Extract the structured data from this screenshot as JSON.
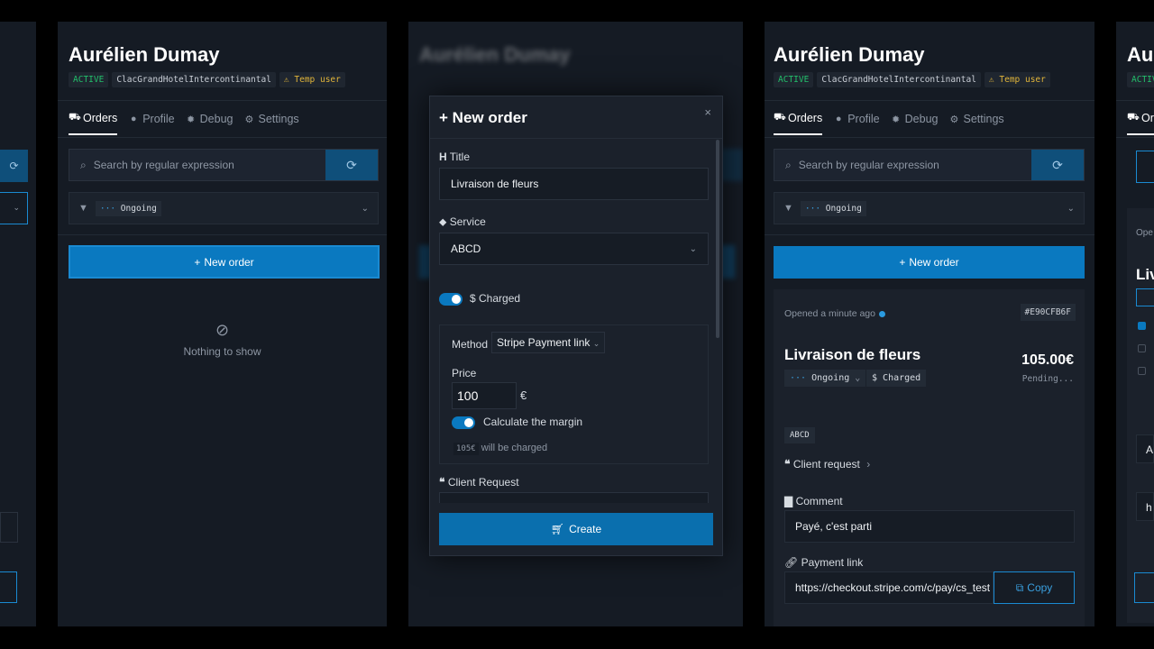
{
  "user": {
    "name": "Aurélien Dumay",
    "status": "ACTIVE",
    "hotel": "ClacGrandHotelIntercontinantal",
    "temp": "Temp user"
  },
  "tabs": [
    {
      "label": "Orders"
    },
    {
      "label": "Profile"
    },
    {
      "label": "Debug"
    },
    {
      "label": "Settings"
    }
  ],
  "search": {
    "placeholder": "Search by regular expression"
  },
  "filter": {
    "tag": "Ongoing"
  },
  "new_order_label": "New order",
  "empty_label": "Nothing to show",
  "modal": {
    "title": "New order",
    "title_label": "Title",
    "title_value": "Livraison de fleurs",
    "service_label": "Service",
    "service_value": "ABCD",
    "charged_label": "Charged",
    "method_label": "Method",
    "method_value": "Stripe Payment link",
    "price_label": "Price",
    "price_value": "100",
    "currency": "€",
    "margin_label": "Calculate the margin",
    "charged_amount": "105€",
    "charged_note": "will be charged",
    "client_request_label": "Client Request",
    "create_label": "Create"
  },
  "order": {
    "opened": "Opened a minute ago",
    "id": "#E90CFB6F",
    "title": "Livraison de fleurs",
    "amount": "105.00€",
    "payment_status": "Pending...",
    "status": "Ongoing",
    "charged": "Charged",
    "service": "ABCD",
    "client_request_label": "Client request",
    "comment_label": "Comment",
    "comment": "Payé, c'est parti",
    "payment_link_label": "Payment link",
    "payment_link": "https://checkout.stripe.com/c/pay/cs_test",
    "copy_label": "Copy"
  },
  "right_edge": {
    "name_partial": "Au",
    "status_partial": "ACTIV",
    "tab_partial": "Or",
    "opened_partial": "Ope",
    "title_partial": "Liv",
    "input_a": "A",
    "input_h": "h"
  },
  "colors": {
    "accent": "#0a79c0",
    "active": "#22c06b",
    "warning": "#e0b43a",
    "panel": "#151b24"
  }
}
